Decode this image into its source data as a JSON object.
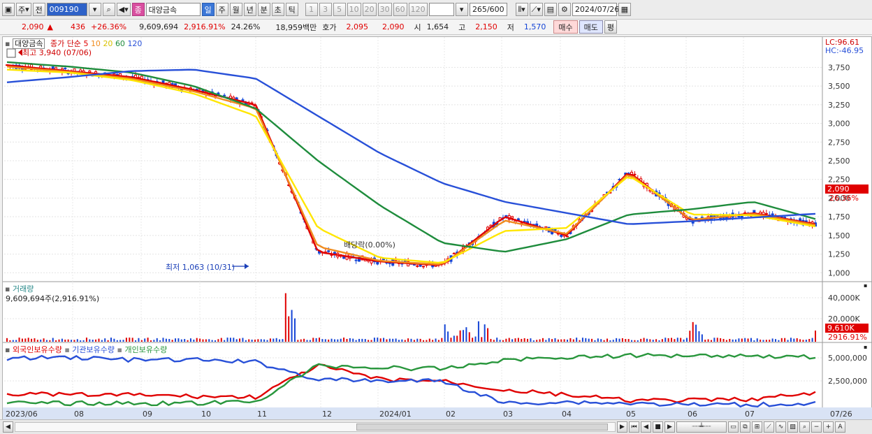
{
  "toolbar": {
    "period_label": "주",
    "prev_label": "전",
    "stock_code": "009190",
    "type_badge": "종",
    "stock_name": "대양금속",
    "periods": [
      "일",
      "주",
      "월",
      "년",
      "분",
      "초",
      "틱"
    ],
    "active_period": "일",
    "intervals": [
      "1",
      "3",
      "5",
      "10",
      "20",
      "30",
      "60",
      "120"
    ],
    "count": "265",
    "count_total": "/600",
    "date": "2024/07/26"
  },
  "quote": {
    "price": "2,090",
    "change_arrow": "▲",
    "change": "436",
    "change_pct": "+26.36%",
    "volume": "9,609,694",
    "volume_pct": "2,916.91%",
    "turnover": "24.26%",
    "amount": "18,959백만",
    "bid_label": "호가",
    "ask": "2,095",
    "bid": "2,090",
    "open_label": "시",
    "open": "1,654",
    "high_label": "고",
    "high": "2,150",
    "low_label": "저",
    "low": "1,570",
    "buy_label": "매수",
    "sell_label": "매도",
    "eval_label": "평"
  },
  "main_panel": {
    "title": "대양금속",
    "ma_label": "종가 단순",
    "ma_periods": [
      "5",
      "10",
      "20",
      "60",
      "120"
    ],
    "high_note": "최고 3,940 (07/06)",
    "low_note": "최저 1,063 (10/31)",
    "dividend_note": "배당락(0.00%)",
    "lc_label": "LC:96.61",
    "hc_label": "HC:-46.95",
    "price_tag": "2,090",
    "pct_tag": "26.36%",
    "y_ticks": [
      "3,750",
      "3,500",
      "3,250",
      "3,000",
      "2,750",
      "2,500",
      "2,250",
      "2,000",
      "1,750",
      "1,500",
      "1,250",
      "1,000"
    ]
  },
  "volume_panel": {
    "title": "거래량",
    "value": "9,609,694주(2,916.91%)",
    "y_ticks": [
      "40,000K",
      "20,000K"
    ],
    "tag": "9,610K",
    "tag_pct": "2916.91%"
  },
  "holdings_panel": {
    "series": [
      "외국인보유수량",
      "기관보유수량",
      "개인보유수량"
    ],
    "y_ticks": [
      "5,000,000",
      "2,500,000"
    ]
  },
  "x_axis": [
    "2023/06",
    "08",
    "09",
    "10",
    "11",
    "12",
    "2024/01",
    "02",
    "03",
    "04",
    "05",
    "06",
    "07",
    "07/26"
  ],
  "colors": {
    "ma5": "#e00000",
    "ma10": "#f08c1e",
    "ma20": "#ffe600",
    "ma60": "#1e8c3c",
    "ma120": "#2850d8",
    "foreign": "#e00000",
    "institution": "#2850d8",
    "individual": "#28963c"
  },
  "chart_data": {
    "type": "line",
    "x": [
      "2023/06",
      "2023/07",
      "2023/08",
      "2023/09",
      "2023/10",
      "2023/11",
      "2023/12",
      "2024/01",
      "2024/02",
      "2024/03",
      "2024/04",
      "2024/05",
      "2024/06",
      "2024/07"
    ],
    "ylim": [
      900,
      3950
    ],
    "series": [
      {
        "name": "5",
        "values": [
          3780,
          3700,
          3620,
          3450,
          3250,
          1280,
          1150,
          1100,
          1750,
          1500,
          2350,
          1700,
          1800,
          1650
        ]
      },
      {
        "name": "10",
        "values": [
          3760,
          3690,
          3600,
          3430,
          3200,
          1350,
          1160,
          1110,
          1700,
          1520,
          2330,
          1710,
          1790,
          1640
        ]
      },
      {
        "name": "20",
        "values": [
          3720,
          3680,
          3580,
          3400,
          3100,
          1600,
          1200,
          1130,
          1560,
          1600,
          2300,
          1780,
          1770,
          1620
        ]
      },
      {
        "name": "60",
        "values": [
          3820,
          3760,
          3680,
          3500,
          3200,
          2500,
          1900,
          1400,
          1280,
          1450,
          1780,
          1850,
          1950,
          1720
        ]
      },
      {
        "name": "120",
        "values": [
          3550,
          3620,
          3700,
          3720,
          3600,
          3100,
          2600,
          2200,
          1950,
          1800,
          1650,
          1690,
          1740,
          1790
        ]
      }
    ]
  }
}
